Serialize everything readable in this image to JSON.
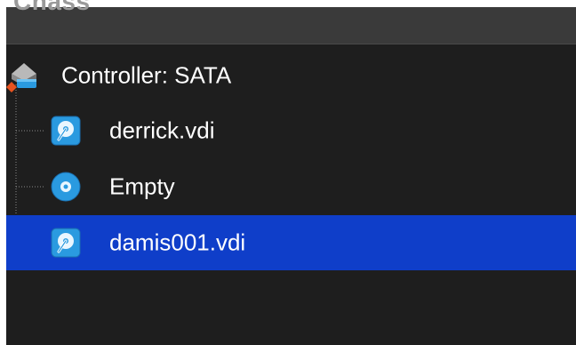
{
  "window": {
    "title_fragment": "Chass"
  },
  "tree": {
    "controller": {
      "label": "Controller: SATA",
      "icon": "sata-controller-icon"
    },
    "attachments": [
      {
        "label": "derrick.vdi",
        "icon": "hard-disk-icon",
        "selected": false
      },
      {
        "label": "Empty",
        "icon": "optical-disc-icon",
        "selected": false
      },
      {
        "label": "damis001.vdi",
        "icon": "hard-disk-icon",
        "selected": true
      }
    ]
  },
  "colors": {
    "background": "#1e1e1e",
    "selection": "#0f3ec9",
    "text": "#ffffff",
    "icon_blue": "#2a9ae0"
  }
}
